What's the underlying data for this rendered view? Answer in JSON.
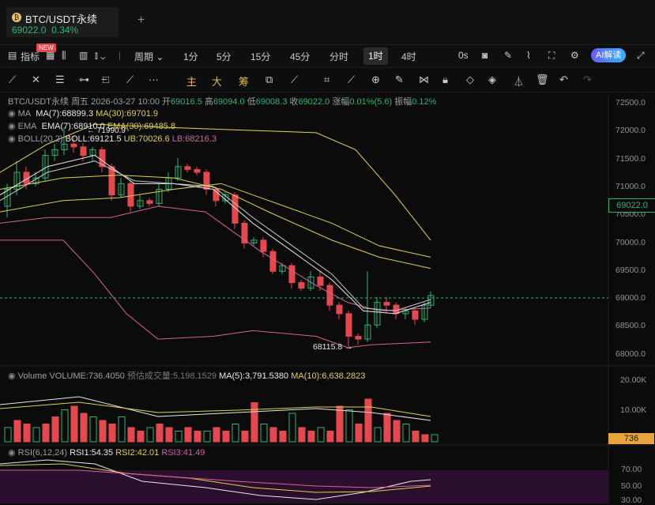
{
  "tab": {
    "coin_glyph": "₿",
    "title": "BTC/USDT永续",
    "price": "69022.0",
    "change": "0.34%",
    "add_label": "+"
  },
  "toolbar": {
    "indicators_label": "指标",
    "new_badge": "NEW",
    "period_label": "周期",
    "timeframes": [
      "1分",
      "5分",
      "15分",
      "45分",
      "分时",
      "1时",
      "4时"
    ],
    "active_timeframe": "1时",
    "countdown": "0s",
    "ai_label": "AI解读"
  },
  "drawing_tools": {
    "main_label": "主",
    "big_label": "大",
    "chip_label": "筹"
  },
  "header": {
    "symbol": "BTC/USDT永续",
    "weekday": "周五",
    "datetime": "2026-03-27 10:00",
    "open_label": "开",
    "open": "69016.5",
    "high_label": "高",
    "high": "69094.0",
    "low_label": "低",
    "low": "69008.3",
    "close_label": "收",
    "close": "69022.0",
    "chg_label": "涨幅",
    "chg": "0.01%(5.6)",
    "amp_label": "振幅",
    "amp": "0.12%"
  },
  "ma": {
    "name": "MA",
    "ma7": "MA(7):68899.3",
    "ma30": "MA(30):69701.9"
  },
  "ema": {
    "name": "EMA",
    "ema7": "EMA(7):68910.0",
    "ema30": "EMA(30):69485.8"
  },
  "boll": {
    "name": "BOLL(20,2)",
    "boll": "BOLL:69121.5",
    "ub": "UB:70026.6",
    "lb": "LB:68216.3"
  },
  "annotations": {
    "high": "71990.9",
    "low": "68115.8 →"
  },
  "price_axis": [
    "72500.0",
    "72000.0",
    "71500.0",
    "71000.0",
    "70500.0",
    "70000.0",
    "69500.0",
    "69000.0",
    "68500.0",
    "68000.0"
  ],
  "current_price": "69022.0",
  "volume": {
    "title": "Volume",
    "vol": "VOLUME:736.4050",
    "est": "预估成交量:5,198.1529",
    "ma5": "MA(5):3,791.5380",
    "ma10": "MA(10):6,638.2823",
    "axis": [
      "20.00K",
      "10.00K"
    ],
    "current": "736"
  },
  "rsi": {
    "title": "RSI(6,12,24)",
    "rsi1": "RSI1:54.35",
    "rsi2": "RSI2:42.01",
    "rsi3": "RSI3:41.49",
    "axis": [
      "70.00",
      "50.00",
      "30.00"
    ]
  },
  "colors": {
    "up": "#2bb673",
    "down": "#e5484d",
    "ma7": "#e8e8e8",
    "ma30": "#e0d14a",
    "boll_upper": "#e6d44a",
    "boll_lower": "#d95fa4",
    "ema": "#c8c8c8"
  }
}
